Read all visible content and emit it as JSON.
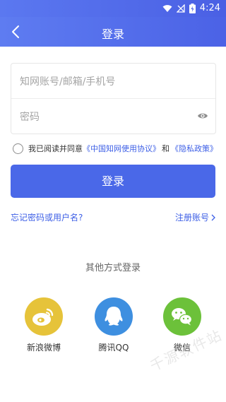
{
  "status_bar": {
    "time": "4:24"
  },
  "app_bar": {
    "title": "登录"
  },
  "form": {
    "account_placeholder": "知网账号/邮箱/手机号",
    "password_placeholder": "密码"
  },
  "agreement": {
    "prefix": "我已阅读并同意",
    "terms_link": "《中国知网使用协议》",
    "conjunction": "和",
    "privacy_link": "《隐私政策》"
  },
  "login_button": "登录",
  "links": {
    "forgot": "忘记密码或用户名?",
    "register": "注册账号"
  },
  "other_login": {
    "title": "其他方式登录",
    "options": [
      {
        "label": "新浪微博",
        "icon": "weibo-icon"
      },
      {
        "label": "腾讯QQ",
        "icon": "qq-icon"
      },
      {
        "label": "微信",
        "icon": "wechat-icon"
      }
    ]
  },
  "watermark": "千源软件站",
  "colors": {
    "accent": "#4a68e8",
    "link": "#3d5fe6",
    "weibo": "#e6c33a",
    "qq": "#3e8fe0",
    "wechat": "#6cc13a"
  }
}
